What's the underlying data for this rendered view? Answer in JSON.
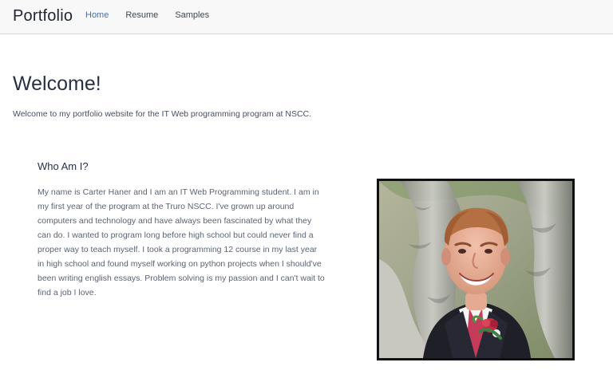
{
  "navbar": {
    "brand": "Portfolio",
    "links": [
      {
        "label": "Home",
        "active": true
      },
      {
        "label": "Resume",
        "active": false
      },
      {
        "label": "Samples",
        "active": false
      }
    ]
  },
  "main": {
    "title": "Welcome!",
    "intro": "Welcome to my portfolio website for the IT Web programming program at NSCC."
  },
  "about": {
    "heading": "Who Am I?",
    "paragraph": "My name is Carter Haner and I am an IT Web Programming student. I am in my first year of the program at the Truro NSCC. I've grown up around computers and technology and have always been fascinated by what they can do. I wanted to program long before high school but could never find a proper way to teach myself. I took a programming 12 course in my last year in high school and found myself working on python projects when I should've been writing english essays. Problem solving is my passion and I can't wait to find a job I love."
  },
  "photo": {
    "border_color": "#111111"
  }
}
